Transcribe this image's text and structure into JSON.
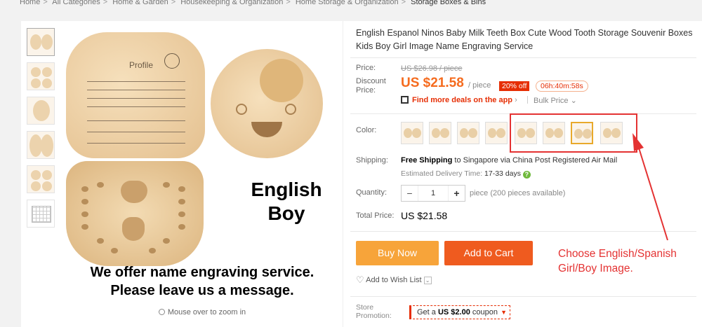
{
  "breadcrumb": [
    "Home",
    "All Categories",
    "Home & Garden",
    "Housekeeping & Organization",
    "Home Storage & Organization",
    "Storage Boxes & Bins"
  ],
  "gallery": {
    "main_image_text": {
      "big_label_line1": "English",
      "big_label_line2": "Boy",
      "engrave_line1": "We offer name engraving service.",
      "engrave_line2": "Please leave us a message.",
      "profile_label": "Profile"
    },
    "zoom_hint": "Mouse over to zoom in"
  },
  "product": {
    "title": "English Espanol Ninos Baby Milk Teeth Box Cute Wood Tooth Storage Souvenir Boxes Kids Boy Girl Image Name Engraving Service",
    "price_label": "Price:",
    "original_price": "US $26.98 / piece",
    "discount_label": "Discount Price:",
    "discount_price": "US $21.58",
    "per_unit": "/ piece",
    "discount_badge": "20% off",
    "countdown": "06h:40m:58s",
    "deals_link": "Find more deals on the app",
    "bulk_price": "Bulk Price",
    "color_label": "Color:",
    "shipping_label": "Shipping:",
    "shipping_free": "Free Shipping",
    "shipping_rest": "to Singapore via China Post Registered Air Mail",
    "delivery_prefix": "Estimated Delivery Time:",
    "delivery_days": "17-33 days",
    "quantity_label": "Quantity:",
    "quantity_value": "1",
    "quantity_note": "piece (200 pieces available)",
    "total_label": "Total Price:",
    "total_value": "US $21.58",
    "buy_now": "Buy Now",
    "add_to_cart": "Add to Cart",
    "wish_list": "Add to Wish List",
    "promo_label": "Store Promotion:",
    "coupon_prefix": "Get a",
    "coupon_amount": "US $2.00",
    "coupon_suffix": "coupon"
  },
  "colors": {
    "selected_index": 6,
    "count": 8,
    "accent": "#f56b1e",
    "annotation": "#e43232"
  },
  "annotation": {
    "text": "Choose English/Spanish Girl/Boy Image."
  }
}
